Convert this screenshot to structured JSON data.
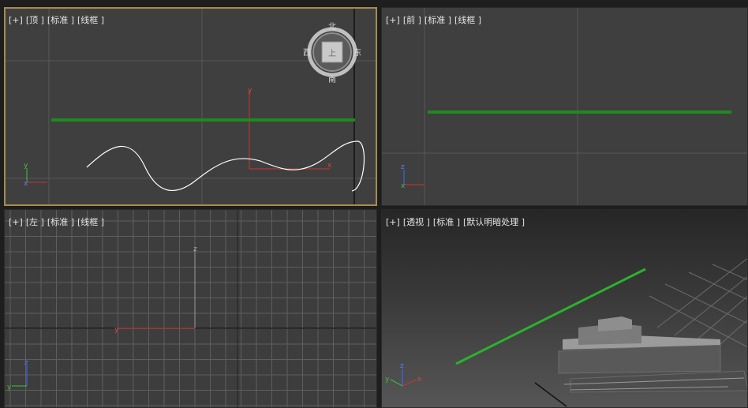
{
  "viewports": {
    "top": {
      "label": {
        "plus": "[+]",
        "view": "[顶 ]",
        "shading": "[标准 ]",
        "mode": "[线框 ]"
      },
      "viewcube": {
        "north": "北",
        "south": "南",
        "east": "东",
        "west": "西",
        "face": "上"
      },
      "axis": {
        "y": "y",
        "x": "x"
      },
      "tripod": {
        "y": "y",
        "x": "x"
      }
    },
    "front": {
      "label": {
        "plus": "[+]",
        "view": "[前 ]",
        "shading": "[标准 ]",
        "mode": "[线框 ]"
      },
      "tripod": {
        "z": "z",
        "x": "x"
      }
    },
    "left": {
      "label": {
        "plus": "[+]",
        "view": "[左 ]",
        "shading": "[标准 ]",
        "mode": "[线框 ]"
      },
      "axis": {
        "z": "z",
        "y": "y"
      },
      "tripod": {
        "z": "z",
        "y": "y"
      }
    },
    "perspective": {
      "label": {
        "plus": "[+]",
        "view": "[透视 ]",
        "shading": "[标准 ]",
        "mode": "[默认明暗处理 ]"
      },
      "tripod": {
        "z": "z",
        "x": "x",
        "y": "y"
      }
    }
  },
  "colors": {
    "spline_green": "#1f8a1f",
    "spline_white": "#ffffff",
    "active_border": "#a58c4e",
    "axis_red": "#d23232",
    "axis_blue": "#3a6cff",
    "axis_green": "#3cc33c"
  }
}
